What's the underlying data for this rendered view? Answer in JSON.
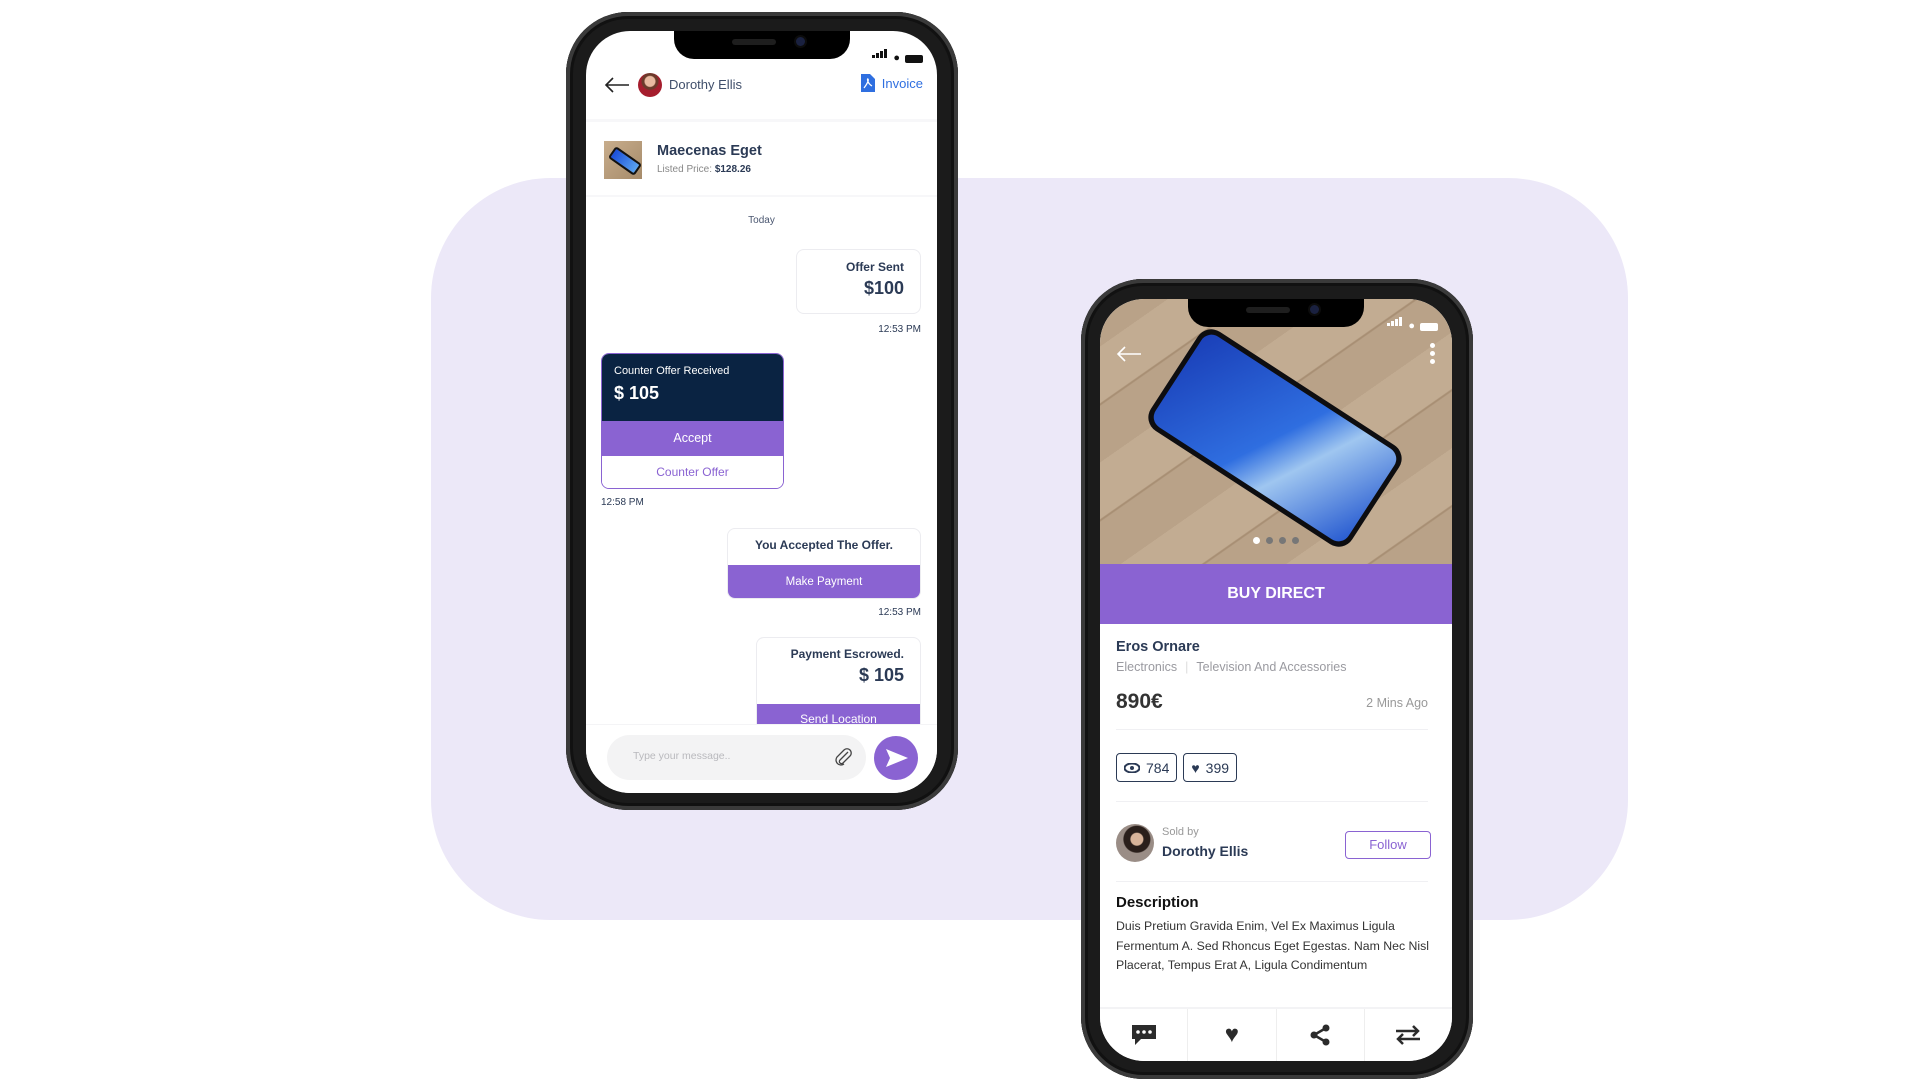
{
  "colors": {
    "accent": "#8a63d2",
    "navy": "#0a2342",
    "background": "#ece8f8",
    "link": "#2f6fe0"
  },
  "chat": {
    "header": {
      "contact_name": "Dorothy Ellis",
      "invoice_label": "Invoice"
    },
    "product": {
      "title": "Maecenas Eget",
      "listed_price_label": "Listed Price:",
      "listed_price": "$128.26"
    },
    "date_separator": "Today",
    "messages": [
      {
        "title": "Offer Sent",
        "amount": "$100",
        "time": "12:53 PM"
      },
      {
        "title": "Counter Offer Received",
        "amount": "$ 105",
        "accept_label": "Accept",
        "counter_label": "Counter Offer",
        "time": "12:58 PM"
      },
      {
        "title": "You Accepted The Offer.",
        "action_label": "Make Payment",
        "time": "12:53 PM"
      },
      {
        "title": "Payment Escrowed.",
        "amount": "$ 105",
        "action_label": "Send Location"
      }
    ],
    "input": {
      "placeholder": "Type your message.."
    }
  },
  "listing": {
    "carousel": {
      "count": 4,
      "active": 1
    },
    "buy_label": "BUY DIRECT",
    "title": "Eros Ornare",
    "categories": [
      "Electronics",
      "Television And Accessories"
    ],
    "price": "890€",
    "posted": "2 Mins Ago",
    "views": "784",
    "likes": "399",
    "seller": {
      "label": "Sold by",
      "name": "Dorothy Ellis",
      "follow_label": "Follow"
    },
    "description": {
      "heading": "Description",
      "text": "Duis Pretium Gravida Enim, Vel Ex Maximus Ligula Fermentum A. Sed Rhoncus Eget Egestas. Nam Nec Nisl Placerat, Tempus Erat A, Ligula Condimentum"
    },
    "bottom_nav": [
      {
        "icon": "chat-icon"
      },
      {
        "icon": "heart-icon"
      },
      {
        "icon": "share-icon"
      },
      {
        "icon": "swap-icon"
      }
    ]
  }
}
